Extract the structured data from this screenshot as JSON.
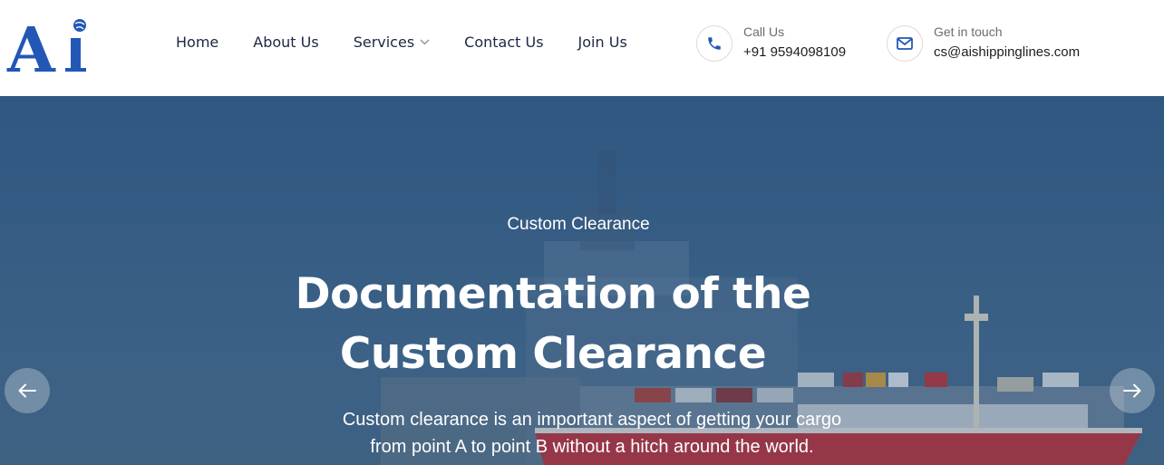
{
  "brand": {
    "logo_text": "Ai",
    "color": "#2257b6"
  },
  "nav": {
    "items": [
      {
        "label": "Home"
      },
      {
        "label": "About Us"
      },
      {
        "label": "Services",
        "has_dropdown": true
      },
      {
        "label": "Contact Us"
      },
      {
        "label": "Join Us"
      }
    ]
  },
  "contact": {
    "call": {
      "label": "Call Us",
      "value": "+91 9594098109",
      "icon": "phone-icon"
    },
    "mail": {
      "label": "Get in touch",
      "value": "cs@aishippinglines.com",
      "icon": "envelope-icon"
    }
  },
  "hero": {
    "eyebrow": "Custom Clearance",
    "headline_line1": "Documentation of the",
    "headline_line2": "Custom Clearance",
    "desc_line1": "Custom clearance is an important aspect of getting your cargo",
    "desc_line2": "from point A to point B without a hitch around the world.",
    "prev_icon": "arrow-left-icon",
    "next_icon": "arrow-right-icon"
  },
  "colors": {
    "accent": "#2257b6",
    "nav_text": "#1c2742",
    "hero_overlay": "#3a6288"
  }
}
